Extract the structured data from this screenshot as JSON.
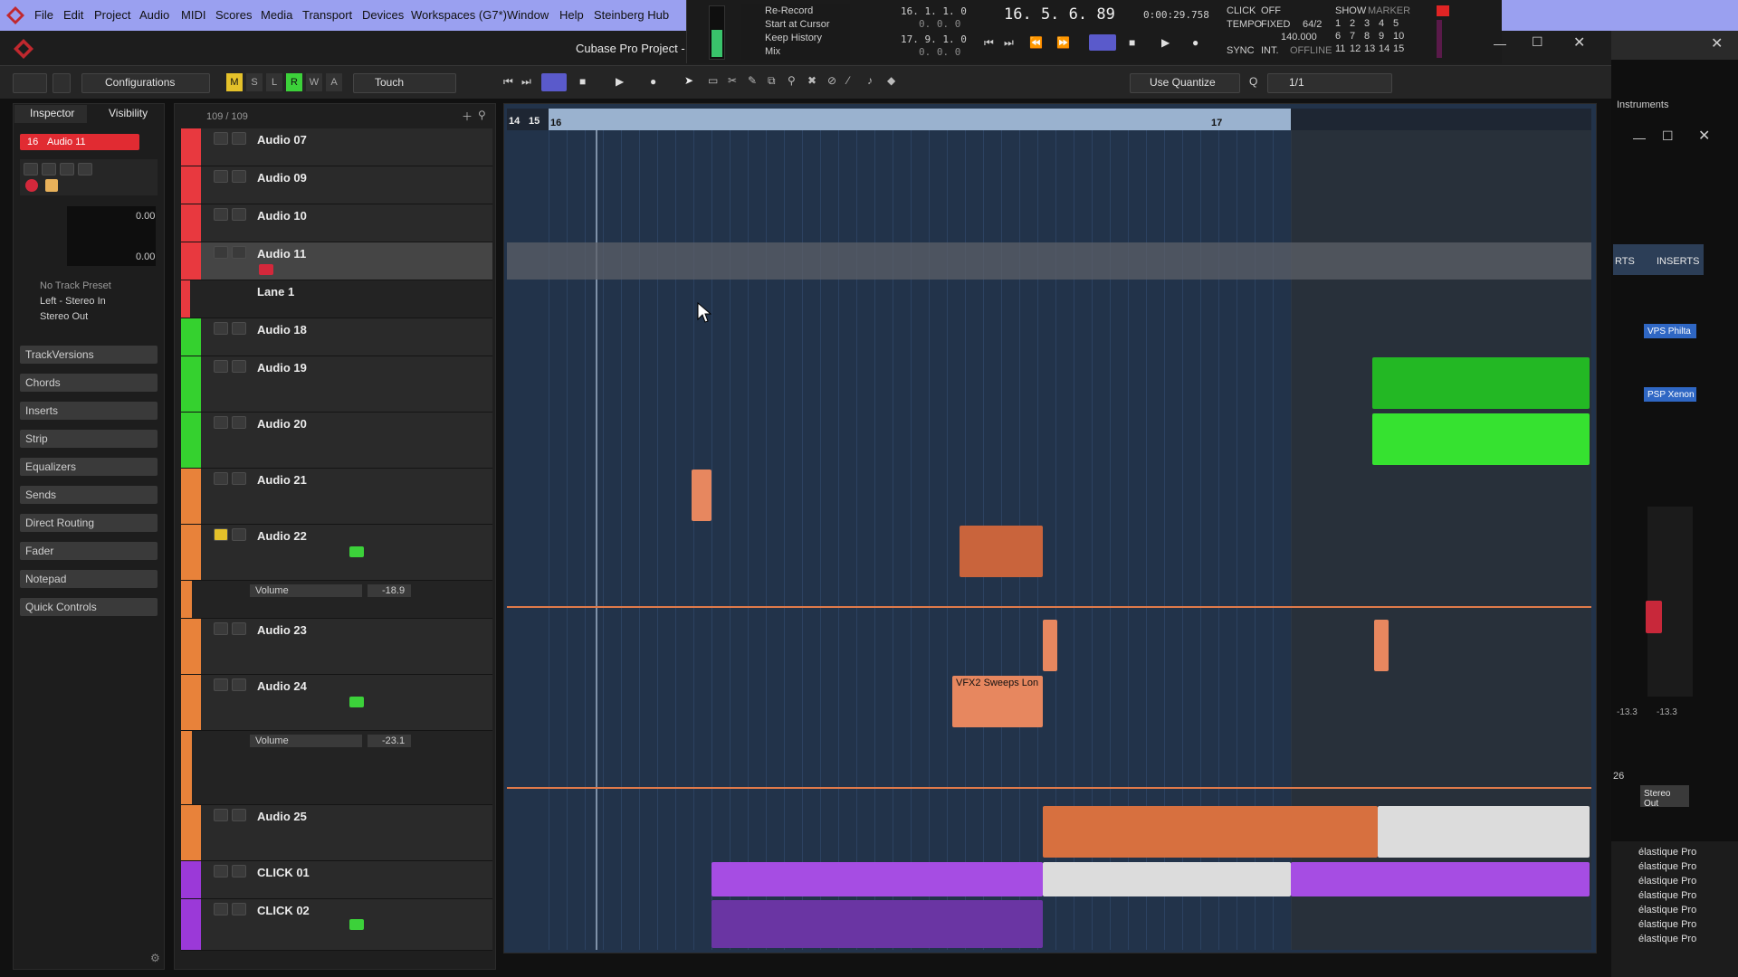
{
  "menu": [
    "File",
    "Edit",
    "Project",
    "Audio",
    "MIDI",
    "Scores",
    "Media",
    "Transport",
    "Devices",
    "Workspaces (G7*)",
    "Window",
    "Help",
    "Steinberg Hub"
  ],
  "window": {
    "title": "Cubase Pro Project -"
  },
  "transport_top": {
    "record_mode": [
      "Re-Record",
      "Start at Cursor",
      "Keep History",
      "Mix"
    ],
    "left_locator": "16. 1. 1.   0",
    "left_locator_sub": "0.   0.   0",
    "right_locator": "17. 9. 1.   0",
    "right_locator_sub": "0.   0.   0",
    "position": "16. 5. 6. 89",
    "time": "0:00:29.758",
    "click": "CLICK",
    "click_state": "OFF",
    "tempo": "TEMPO",
    "tempo_mode": "FIXED",
    "tempo_sig": "64/2",
    "tempo_value": "140.000",
    "sync": "SYNC",
    "sync_mode": "INT.",
    "sync_state": "OFFLINE",
    "show": "SHOW",
    "marker": "MARKER",
    "marker_nums": [
      "1",
      "2",
      "3",
      "4",
      "5",
      "6",
      "7",
      "8",
      "9",
      "10",
      "11",
      "12",
      "13",
      "14",
      "15"
    ]
  },
  "toolbar": {
    "configurations": "Configurations",
    "touch": "Touch",
    "quantize": "Use Quantize",
    "q_value": "1/1",
    "mode_labels": [
      "M",
      "S",
      "L",
      "R",
      "W",
      "A"
    ]
  },
  "inspector": {
    "tabs": [
      "Inspector",
      "Visibility"
    ],
    "track_name": "Audio 11",
    "track_number": "16",
    "value_1": "0.00",
    "value_2": "0.00",
    "preset": "No Track Preset",
    "input": "Left - Stereo In",
    "output": "Stereo Out",
    "sections": [
      "TrackVersions",
      "Chords",
      "Inserts",
      "Strip",
      "Equalizers",
      "Sends",
      "Direct Routing",
      "Fader",
      "Notepad",
      "Quick Controls"
    ]
  },
  "track_list": {
    "counter": "109 / 109",
    "tracks": [
      {
        "name": "Audio 07",
        "color": "#e8393f"
      },
      {
        "name": "Audio 09",
        "color": "#e8393f"
      },
      {
        "name": "Audio 10",
        "color": "#e8393f"
      },
      {
        "name": "Audio 11",
        "color": "#e8393f"
      },
      {
        "name": "Lane 1",
        "color": "#e8393f"
      },
      {
        "name": "Audio 18",
        "color": "#35d12f"
      },
      {
        "name": "Audio 19",
        "color": "#35d12f"
      },
      {
        "name": "Audio 20",
        "color": "#35d12f"
      },
      {
        "name": "Audio 21",
        "color": "#e8823a"
      },
      {
        "name": "Audio 22",
        "color": "#e8823a"
      },
      {
        "name": "Volume",
        "value": "-18.9",
        "color": "#e8823a"
      },
      {
        "name": "Audio 23",
        "color": "#e8823a"
      },
      {
        "name": "Audio 24",
        "color": "#e8823a"
      },
      {
        "name": "Volume",
        "value": "-23.1",
        "color": "#e8823a"
      },
      {
        "name": "Audio 25",
        "color": "#e8823a"
      },
      {
        "name": "CLICK 01",
        "color": "#9b39d8"
      },
      {
        "name": "CLICK 02",
        "color": "#9b39d8"
      }
    ]
  },
  "ruler": {
    "bar_14": "14",
    "bar_15": "15",
    "bar_16": "16",
    "bar_17": "17"
  },
  "clips": {
    "vfx": "VFX2 Sweeps Lon"
  },
  "right_panel": {
    "instruments": "Instruments",
    "inserts": "INSERTS",
    "rts": "RTS",
    "plugin_1": "VPS Philta",
    "plugin_2": "PSP Xenon",
    "fader_vals": [
      "-13.3",
      "-13.3"
    ],
    "out_num": "26",
    "out_label": "Stereo Out",
    "algo_rows": [
      "élastique Pro",
      "élastique Pro",
      "élastique Pro",
      "élastique Pro",
      "élastique Pro",
      "élastique Pro",
      "élastique Pro"
    ]
  }
}
